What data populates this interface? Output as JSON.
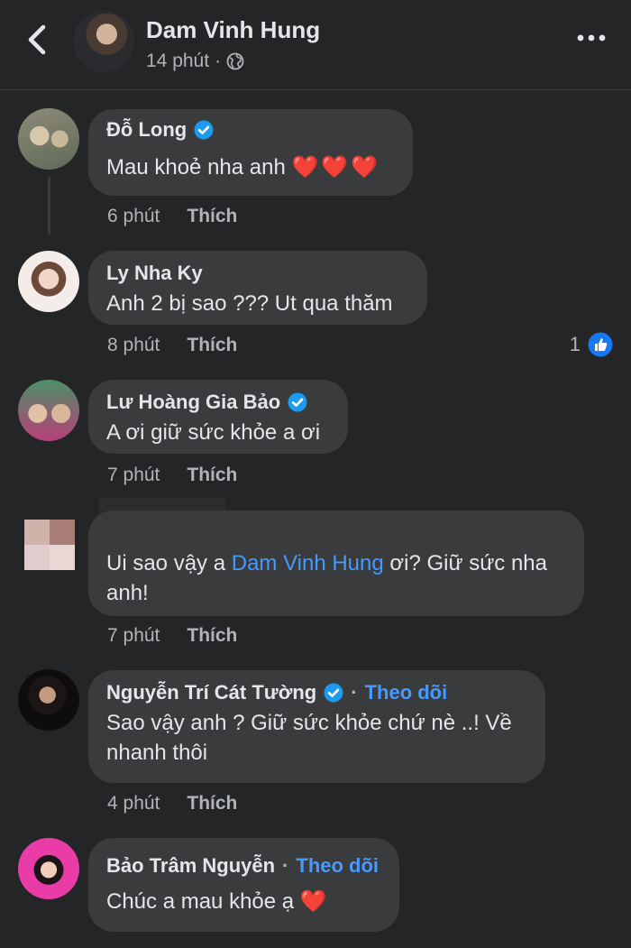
{
  "header": {
    "author": "Dam Vinh Hung",
    "time": "14 phút",
    "separator": "·",
    "icons": {
      "back": "chevron-left-icon",
      "privacy": "globe-icon",
      "more": "more-horizontal-icon"
    }
  },
  "colors": {
    "background": "#242526",
    "bubble": "#3a3b3c",
    "link": "#4599ff",
    "verified": "#1d9bf0",
    "heart": "#e8192c"
  },
  "comments": [
    {
      "name": "Đỗ Long",
      "verified": true,
      "text": "Mau khoẻ nha anh",
      "emoji": "❤️❤️❤️",
      "time": "6 phút",
      "like_label": "Thích"
    },
    {
      "name": "Ly Nha Ky",
      "verified": false,
      "text": "Anh 2 bị sao ??? Ut qua thăm",
      "time": "8 phút",
      "like_label": "Thích",
      "reaction_count": "1"
    },
    {
      "name": "Lư Hoàng Gia Bảo",
      "verified": true,
      "text": "A ơi giữ sức khỏe a ơi",
      "time": "7 phút",
      "like_label": "Thích"
    },
    {
      "name": "",
      "verified": false,
      "text_before": "Ui sao vậy a ",
      "mention": "Dam Vinh Hung",
      "text_after": " ơi? Giữ sức nha anh!",
      "time": "7 phút",
      "like_label": "Thích"
    },
    {
      "name": "Nguyễn Trí Cát Tường",
      "verified": true,
      "follow_label": "Theo dõi",
      "text": "Sao vậy anh ? Giữ sức khỏe chứ nè ..! Về nhanh thôi",
      "time": "4 phút",
      "like_label": "Thích"
    },
    {
      "name": "Bảo Trâm Nguyễn",
      "verified": false,
      "follow_label": "Theo dõi",
      "text": "Chúc a mau khỏe ạ",
      "emoji": "❤️"
    }
  ]
}
